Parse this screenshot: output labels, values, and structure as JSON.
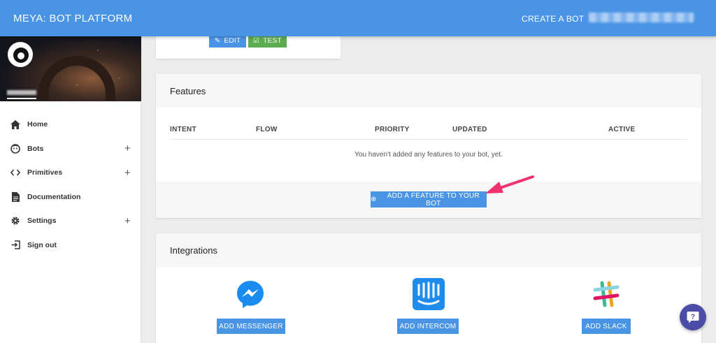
{
  "header": {
    "brand": "MEYA: BOT PLATFORM",
    "create_bot": "CREATE A BOT"
  },
  "sidebar": {
    "items": [
      {
        "label": "Home",
        "icon": "home-icon",
        "expandable": false
      },
      {
        "label": "Bots",
        "icon": "bot-face-icon",
        "expandable": true
      },
      {
        "label": "Primitives",
        "icon": "code-icon",
        "expandable": true
      },
      {
        "label": "Documentation",
        "icon": "document-icon",
        "expandable": false
      },
      {
        "label": "Settings",
        "icon": "gear-icon",
        "expandable": true
      },
      {
        "label": "Sign out",
        "icon": "sign-out-icon",
        "expandable": false
      }
    ]
  },
  "top_card": {
    "edit_label": "EDIT",
    "test_label": "TEST"
  },
  "features": {
    "title": "Features",
    "columns": [
      "INTENT",
      "FLOW",
      "PRIORITY",
      "UPDATED",
      "ACTIVE"
    ],
    "empty_message": "You haven't added any features to your bot, yet.",
    "add_label": "ADD A FEATURE TO YOUR BOT"
  },
  "integrations": {
    "title": "Integrations",
    "items": [
      {
        "label": "ADD MESSENGER",
        "icon": "messenger-icon"
      },
      {
        "label": "ADD INTERCOM",
        "icon": "intercom-icon"
      },
      {
        "label": "ADD SLACK",
        "icon": "slack-icon"
      }
    ]
  },
  "colors": {
    "primary": "#4a94e6",
    "success": "#5cad4f",
    "annotation": "#f0336f",
    "help": "#4b4ba8"
  }
}
